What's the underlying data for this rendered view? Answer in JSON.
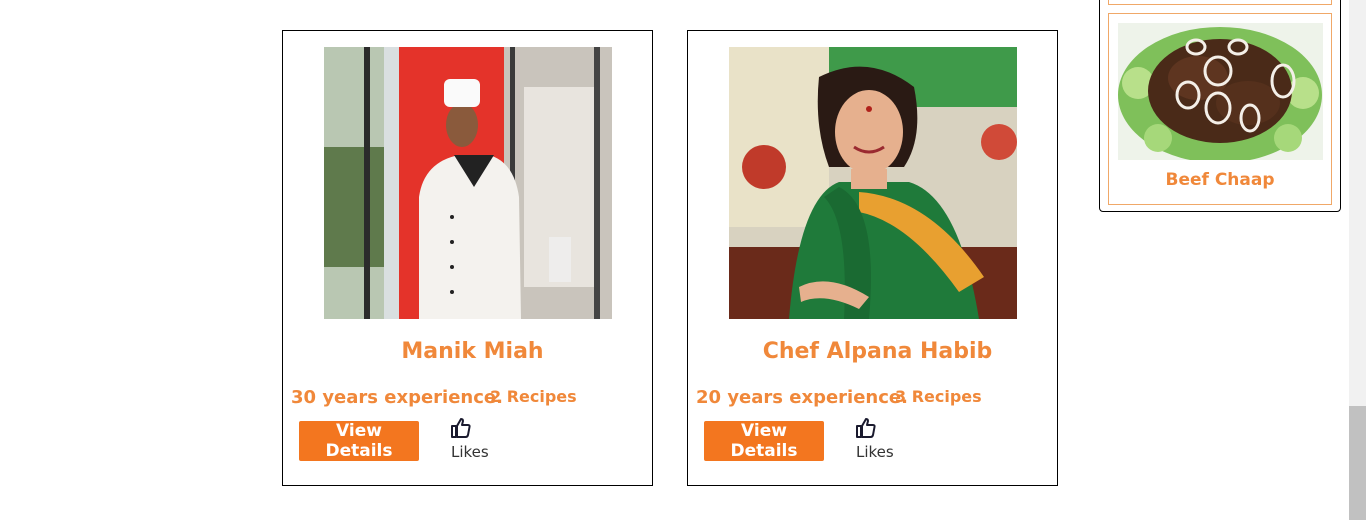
{
  "chefs": [
    {
      "name": "Manik Miah",
      "experience": "30 years experience.",
      "recipes": "2 Recipes",
      "button_label": "View Details",
      "likes_label": "Likes"
    },
    {
      "name": "Chef Alpana Habib",
      "experience": "20 years experience.",
      "recipes": "3 Recipes",
      "button_label": "View Details",
      "likes_label": "Likes"
    }
  ],
  "sidebar": {
    "recipe_title": "Beef Chaap"
  },
  "colors": {
    "accent": "#f0883a",
    "button": "#f3761f",
    "border": "#000000"
  },
  "icons": {
    "like": "thumbs-up-icon"
  }
}
